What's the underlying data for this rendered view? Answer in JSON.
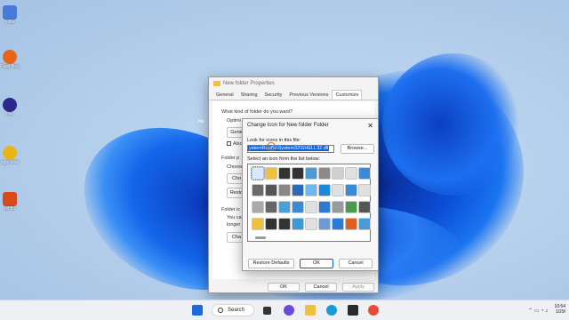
{
  "desktop": {
    "icons": [
      {
        "label": "n file",
        "color": "#4a7ad8"
      },
      {
        "label": "Pass\nfiles",
        "color": "#e8641a"
      },
      {
        "label": "Pro",
        "color": "#2a2a8a"
      },
      {
        "label": "ogle\nome",
        "color": "#e8b61a"
      },
      {
        "label": "nd\nllo",
        "color": "#d84a1a"
      }
    ]
  },
  "properties_window": {
    "title": "New folder Properties",
    "tabs": [
      "General",
      "Sharing",
      "Security",
      "Previous Versions",
      "Customize"
    ],
    "active_tab": "Customize",
    "question": "What kind of folder do you want?",
    "optimize_label": "Optimi",
    "general_label": "Gene",
    "also_label": "Also",
    "folder_pictures_label": "Folder p",
    "choose_label": "Choose",
    "choose_btn": "Cho",
    "restore_btn": "Resto",
    "folder_icons_label": "Folder ic",
    "you_can_label": "You ca",
    "longer_label": "longer s",
    "change_btn": "Cha",
    "ok": "OK",
    "cancel": "Cancel",
    "apply": "Apply",
    "new_label": "Ne"
  },
  "change_icon_dialog": {
    "title": "Change Icon for New folder Folder",
    "close_glyph": "✕",
    "look_label": "Look for icons in this file:",
    "path_value": "ystemRoot%\\System32\\SHELL32.dll",
    "browse": "Browse...",
    "select_label": "Select an icon from the list below:",
    "restore_defaults": "Restore Defaults",
    "ok": "OK",
    "cancel": "Cancel",
    "icon_colors": [
      "#ffffff",
      "#f0c040",
      "#333333",
      "#333333",
      "#4a9ad8",
      "#8a8a8a",
      "#d0d0d0",
      "#e0e0e0",
      "#3a8ad8",
      "#6a6a6a",
      "#555555",
      "#888888",
      "#2a6ab8",
      "#6abaf0",
      "#1a8ad8",
      "#e0e0e0",
      "#3a8ad8",
      "#e0e0e0",
      "#aaaaaa",
      "#666666",
      "#4aa0d8",
      "#3a8ad8",
      "#e0e0e0",
      "#2a7ad8",
      "#9a9a9a",
      "#4a9a4a",
      "#555555",
      "#f0c040",
      "#333333",
      "#333333",
      "#3a9ad8",
      "#e0e0e0",
      "#6a9ad8",
      "#2a7ad8",
      "#e06020",
      "#4a9ad8"
    ]
  },
  "taskbar": {
    "search_label": "Search",
    "time": "10:54",
    "date": "1/29/",
    "items": [
      {
        "name": "start-icon",
        "color": "#1a6ad8"
      },
      {
        "name": "task-view-icon",
        "color": "#333333"
      },
      {
        "name": "teams-icon",
        "color": "#6a4ad8"
      },
      {
        "name": "explorer-icon",
        "color": "#f0c040"
      },
      {
        "name": "edge-icon",
        "color": "#1a9ad8"
      },
      {
        "name": "store-icon",
        "color": "#2a2a2a"
      },
      {
        "name": "chrome-icon",
        "color": "#e84a3a"
      }
    ]
  }
}
